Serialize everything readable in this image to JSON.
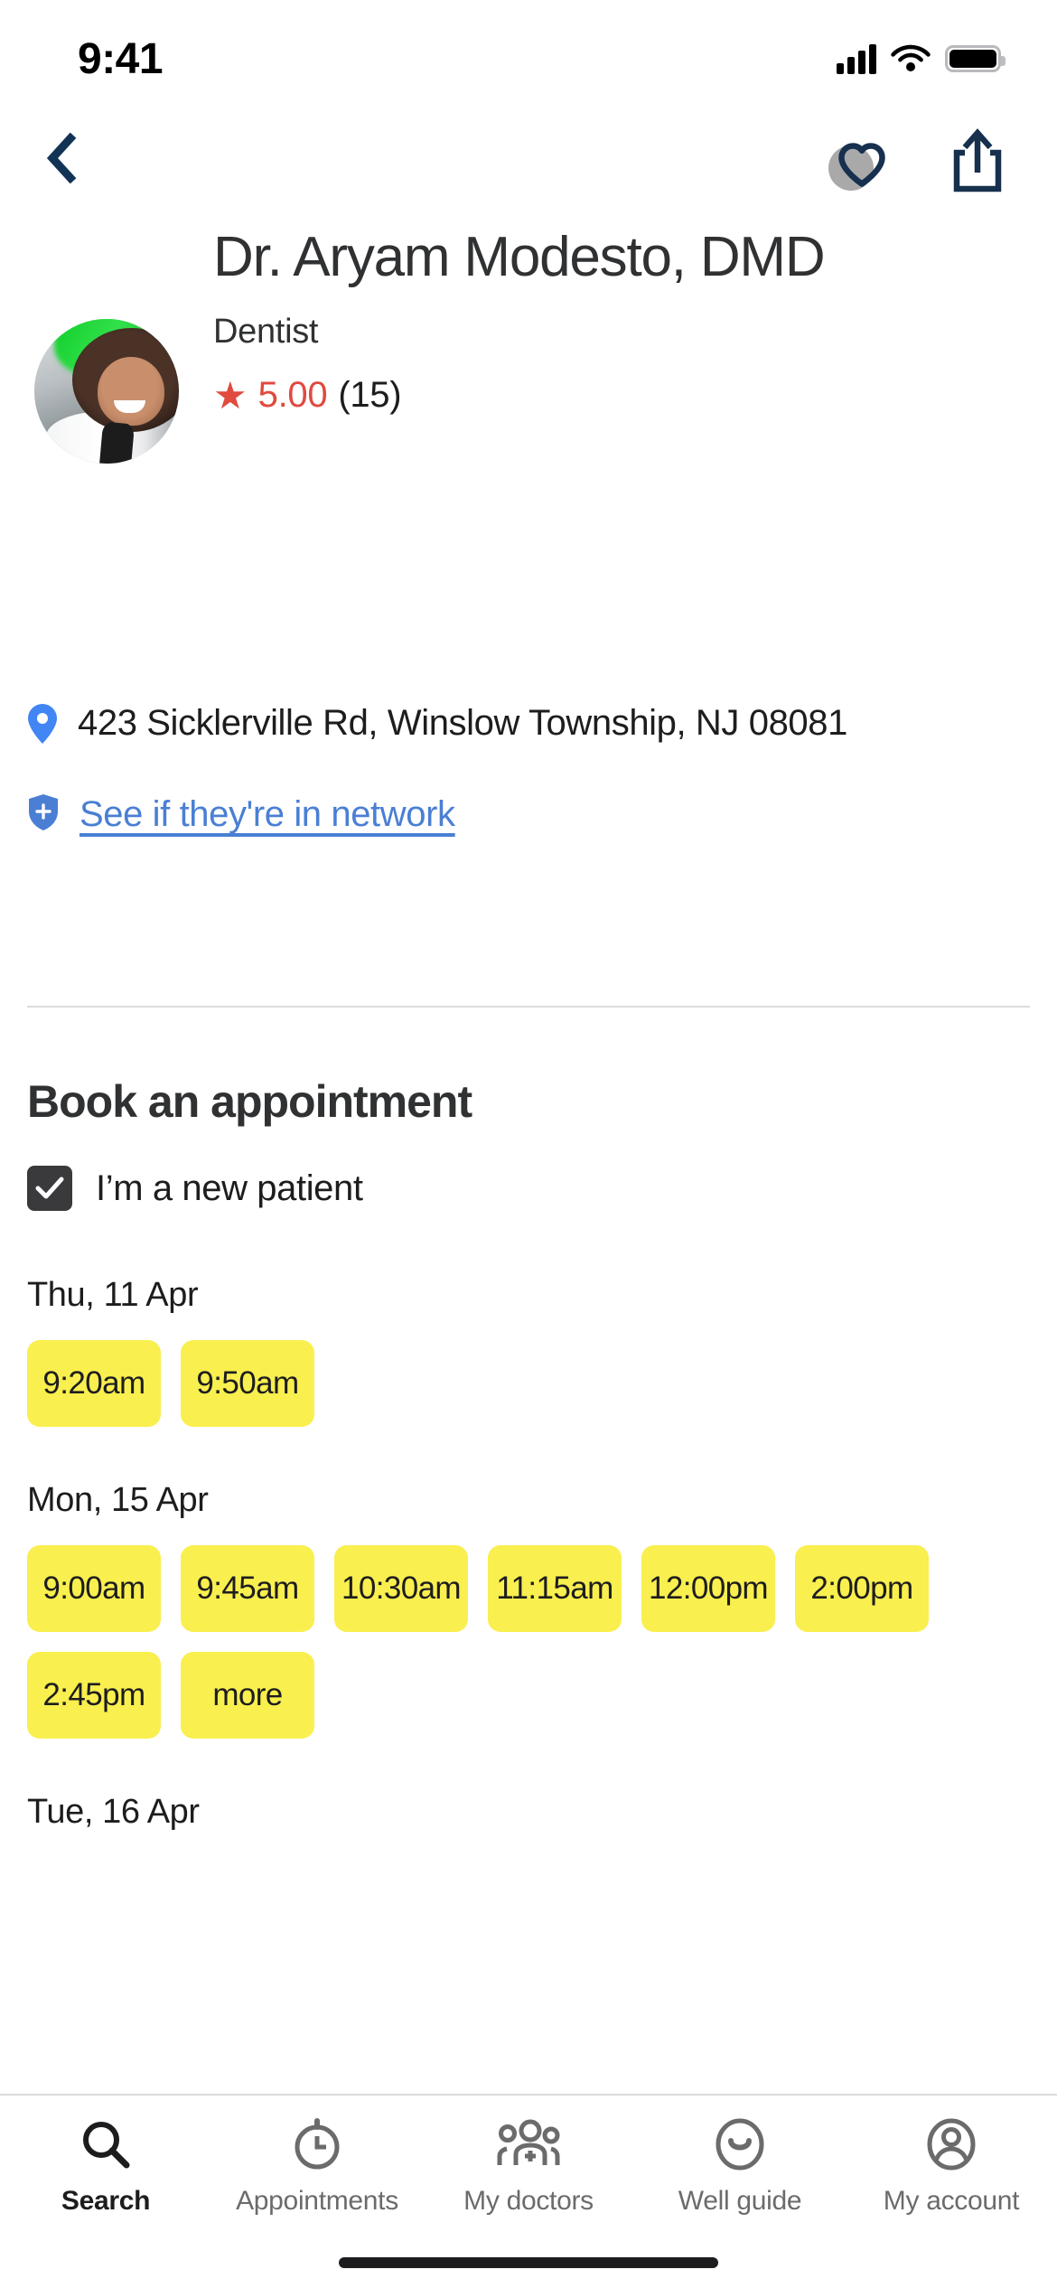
{
  "status_bar": {
    "time": "9:41",
    "cellular_icon": "cellular-signal-icon",
    "wifi_icon": "wifi-icon",
    "battery_icon": "battery-icon"
  },
  "nav": {
    "back_icon": "chevron-left-icon",
    "favorite_icon": "heart-icon",
    "share_icon": "share-icon"
  },
  "doctor": {
    "avatar": "doctor-photo",
    "name": "Dr. Aryam Modesto, DMD",
    "specialty": "Dentist",
    "rating_star": "★",
    "rating_value": "5.00",
    "rating_count": "(15)",
    "rating_color": "#e04a3f"
  },
  "location": {
    "pin_icon": "map-pin-icon",
    "address": "423 Sicklerville Rd, Winslow Township, NJ 08081",
    "shield_icon": "shield-plus-icon",
    "network_link": "See if they're in network",
    "link_color": "#4a7fd4"
  },
  "booking": {
    "title": "Book an appointment",
    "new_patient_label": "I’m a new patient",
    "new_patient_checked": true,
    "slot_color": "#f9ef4e",
    "days": [
      {
        "label": "Thu, 11 Apr",
        "slots": [
          "9:20am",
          "9:50am"
        ]
      },
      {
        "label": "Mon, 15 Apr",
        "slots": [
          "9:00am",
          "9:45am",
          "10:30am",
          "11:15am",
          "12:00pm",
          "2:00pm",
          "2:45pm",
          "more"
        ]
      },
      {
        "label": "Tue, 16 Apr",
        "slots": []
      }
    ]
  },
  "tabbar": {
    "items": [
      {
        "label": "Search",
        "icon": "search-icon",
        "active": true
      },
      {
        "label": "Appointments",
        "icon": "stopwatch-icon",
        "active": false
      },
      {
        "label": "My doctors",
        "icon": "people-plus-icon",
        "active": false
      },
      {
        "label": "Well guide",
        "icon": "smiley-icon",
        "active": false
      },
      {
        "label": "My account",
        "icon": "account-circle-icon",
        "active": false
      }
    ]
  }
}
